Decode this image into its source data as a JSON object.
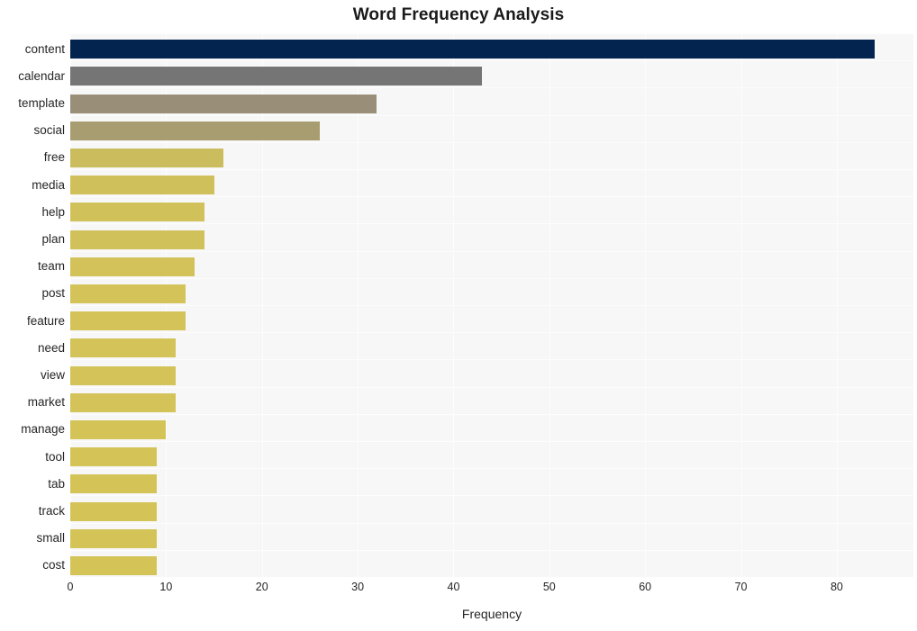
{
  "chart_data": {
    "type": "bar",
    "orientation": "horizontal",
    "title": "Word Frequency Analysis",
    "xlabel": "Frequency",
    "ylabel": "",
    "xlim": [
      0,
      88
    ],
    "xticks": [
      0,
      10,
      20,
      30,
      40,
      50,
      60,
      70,
      80
    ],
    "xticklabels": [
      "0",
      "10",
      "20",
      "30",
      "40",
      "50",
      "60",
      "70",
      "80"
    ],
    "grid": true,
    "legend": false,
    "categories": [
      "content",
      "calendar",
      "template",
      "social",
      "free",
      "media",
      "help",
      "plan",
      "team",
      "post",
      "feature",
      "need",
      "view",
      "market",
      "manage",
      "tool",
      "tab",
      "track",
      "small",
      "cost"
    ],
    "values": [
      84,
      43,
      32,
      26,
      16,
      15,
      14,
      14,
      13,
      12,
      12,
      11,
      11,
      11,
      10,
      9,
      9,
      9,
      9,
      9
    ],
    "bar_colors": [
      "#042450",
      "#757575",
      "#998f78",
      "#a89d70",
      "#cbbd5e",
      "#d0c05b",
      "#d1c15a",
      "#d1c15a",
      "#d2c259",
      "#d3c359",
      "#d3c359",
      "#d3c358",
      "#d3c358",
      "#d3c358",
      "#d4c457",
      "#d4c457",
      "#d4c457",
      "#d4c457",
      "#d4c457",
      "#d4c457"
    ],
    "plot_background": "#f7f7f7",
    "grid_color": "#fdfdfd",
    "figure_background": "#ffffff"
  },
  "axes": {
    "x_axis_title": "Frequency",
    "y_axis_title": ""
  }
}
